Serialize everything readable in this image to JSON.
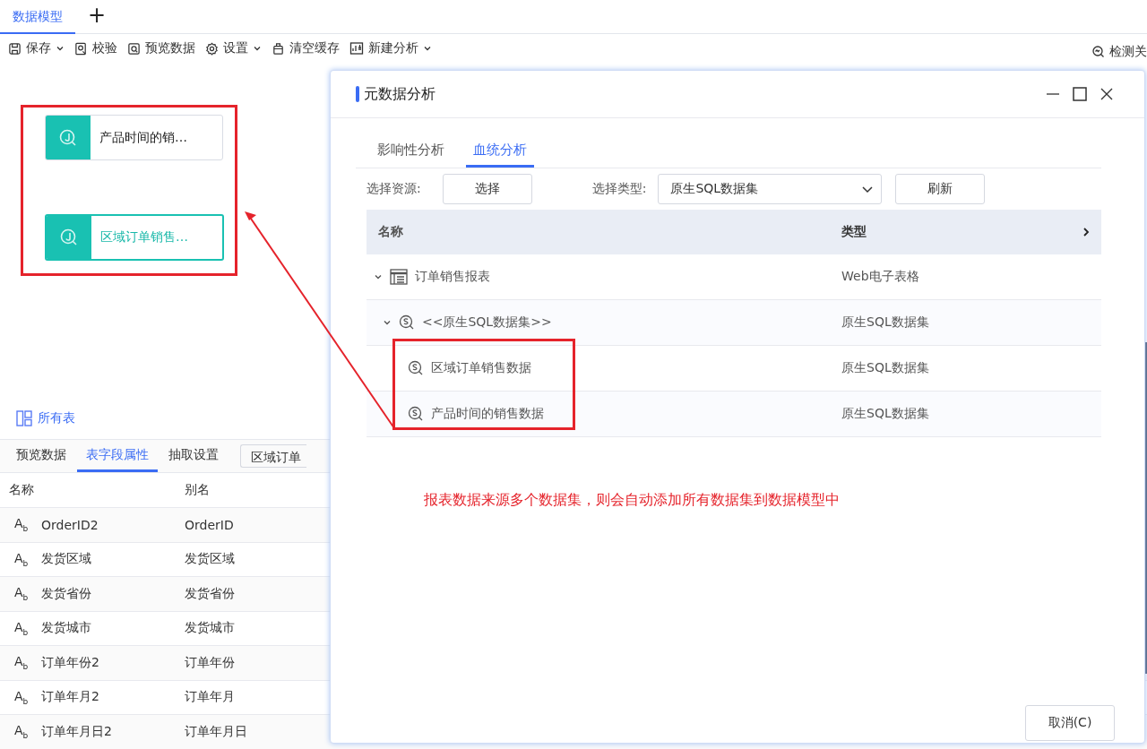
{
  "doc_tabs": [
    {
      "label": "数据模型",
      "selected": true
    }
  ],
  "add_tab": "+",
  "toolbar": [
    {
      "label": "保存",
      "kind": "save",
      "dropdown": true
    },
    {
      "label": "校验",
      "kind": "check",
      "dropdown": false
    },
    {
      "label": "预览数据",
      "kind": "preview",
      "dropdown": false
    },
    {
      "label": "设置",
      "kind": "gear",
      "dropdown": true
    },
    {
      "label": "清空缓存",
      "kind": "clear",
      "dropdown": false
    },
    {
      "label": "新建分析",
      "kind": "analysis",
      "dropdown": true
    }
  ],
  "detect_button": "检测关",
  "canvas_nodes": [
    {
      "label": "产品时间的销…",
      "selected": false
    },
    {
      "label": "区域订单销售…",
      "selected": true
    }
  ],
  "all_tables": "所有表",
  "panel_tabs": [
    {
      "label": "预览数据",
      "selected": false
    },
    {
      "label": "表字段属性",
      "selected": true
    },
    {
      "label": "抽取设置",
      "selected": false
    }
  ],
  "table_select": "区域订单",
  "fields": {
    "columns": [
      "名称",
      "别名"
    ],
    "rows": [
      {
        "type": "A$_{b}$",
        "name": "OrderID2",
        "alias": "OrderID"
      },
      {
        "type": "A$_{b}$",
        "name": "发货区域",
        "alias": "发货区域"
      },
      {
        "type": "A$_{b}$",
        "name": "发货省份",
        "alias": "发货省份"
      },
      {
        "type": "A$_{b}$",
        "name": "发货城市",
        "alias": "发货城市"
      },
      {
        "type": "A$_{b}$",
        "name": "订单年份2",
        "alias": "订单年份"
      },
      {
        "type": "A$_{b}$",
        "name": "订单年月2",
        "alias": "订单年月"
      },
      {
        "type": "A$_{b}$",
        "name": "订单年月日2",
        "alias": "订单年月日"
      }
    ]
  },
  "dialog": {
    "title": "元数据分析",
    "tabs": [
      {
        "label": "影响性分析",
        "selected": false
      },
      {
        "label": "血统分析",
        "selected": true
      }
    ],
    "resource_label": "选择资源:",
    "resource_button": "选择",
    "type_label": "选择类型:",
    "type_value": "原生SQL数据集",
    "refresh_button": "刷新",
    "columns": [
      "名称",
      "类型"
    ],
    "tree": [
      {
        "name": "订单销售报表",
        "type": "Web电子表格",
        "kind": "report",
        "expanded": true,
        "children": [
          {
            "name": "<<原生SQL数据集>>",
            "type": "原生SQL数据集",
            "kind": "sql",
            "expanded": true,
            "children": [
              {
                "name": "区域订单销售数据",
                "type": "原生SQL数据集",
                "kind": "sql"
              },
              {
                "name": "产品时间的销售数据",
                "type": "原生SQL数据集",
                "kind": "sql"
              }
            ]
          }
        ]
      }
    ],
    "note": "报表数据来源多个数据集，则会自动添加所有数据集到数据模型中",
    "cancel_button": "取消(C)"
  }
}
